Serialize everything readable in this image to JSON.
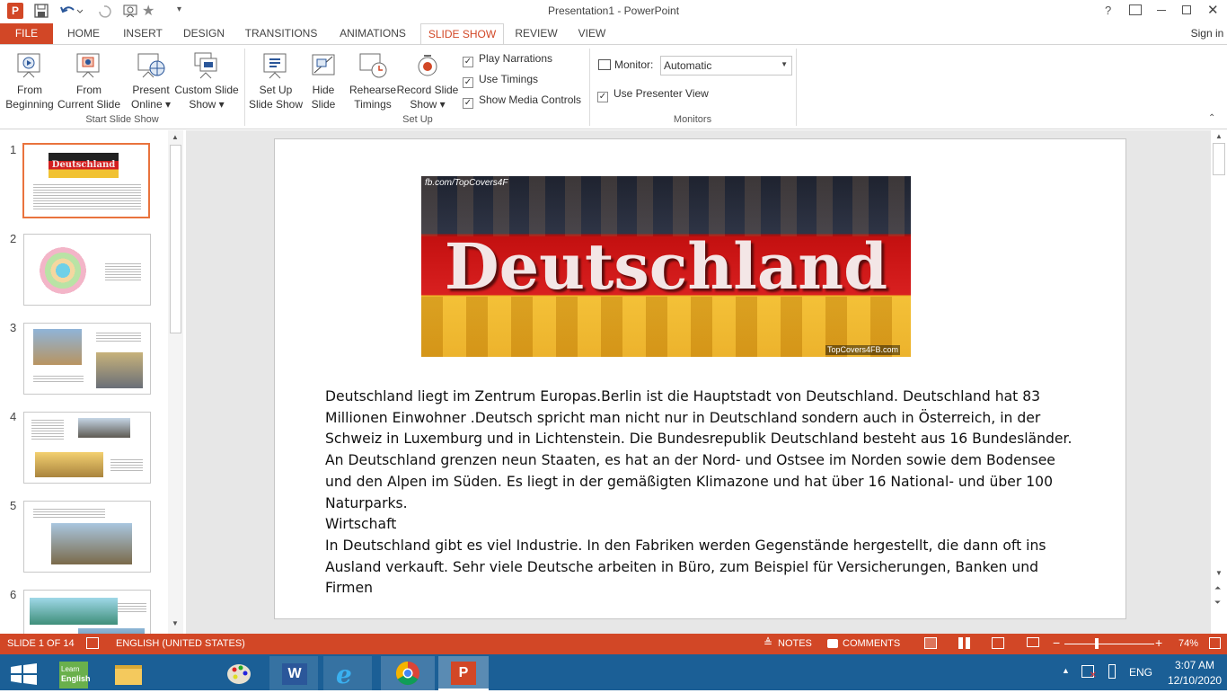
{
  "title_bar": {
    "title": "Presentation1 - PowerPoint",
    "help": "?"
  },
  "tabs": [
    {
      "label": "FILE"
    },
    {
      "label": "HOME"
    },
    {
      "label": "INSERT"
    },
    {
      "label": "DESIGN"
    },
    {
      "label": "TRANSITIONS"
    },
    {
      "label": "ANIMATIONS"
    },
    {
      "label": "SLIDE SHOW"
    },
    {
      "label": "REVIEW"
    },
    {
      "label": "VIEW"
    }
  ],
  "sign_in": "Sign in",
  "ribbon": {
    "from_beginning": [
      "From",
      "Beginning"
    ],
    "from_current": [
      "From",
      "Current Slide"
    ],
    "present_online": [
      "Present",
      "Online ▾"
    ],
    "custom_show": [
      "Custom Slide",
      "Show ▾"
    ],
    "setup_show": [
      "Set Up",
      "Slide Show"
    ],
    "hide_slide": [
      "Hide",
      "Slide"
    ],
    "rehearse": [
      "Rehearse",
      "Timings"
    ],
    "record": [
      "Record Slide",
      "Show ▾"
    ],
    "play_narrations": "Play Narrations",
    "use_timings": "Use Timings",
    "show_media": "Show Media Controls",
    "monitor_label": "Monitor:",
    "monitor_value": "Automatic",
    "presenter_view": "Use Presenter View",
    "groups": {
      "start": "Start Slide Show",
      "setup": "Set Up",
      "monitors": "Monitors"
    }
  },
  "thumbnails": [
    {
      "num": "1",
      "title": "Deutschland"
    },
    {
      "num": "2"
    },
    {
      "num": "3"
    },
    {
      "num": "4"
    },
    {
      "num": "5"
    },
    {
      "num": "6"
    }
  ],
  "slide": {
    "banner_title": "Deutschland",
    "banner_tl": "fb.com/TopCovers4F",
    "banner_br": "TopCovers4FB.com",
    "lines": [
      "Deutschland liegt im Zentrum Europas.Berlin ist die Hauptstadt von Deutschland. Deutschland hat 83",
      "Millionen Einwohner .Deutsch spricht man nicht nur in Deutschland sondern auch  in Österreich, in der",
      "Schweiz in Luxemburg und in Lichtenstein.  Die Bundesrepublik Deutschland besteht aus 16 Bundesländer.",
      "An Deutschland grenzen neun Staaten, es hat an der Nord- und Ostsee im Norden sowie dem Bodensee",
      "und den Alpen im Süden. Es liegt in der gemäßigten Klimazone und hat  über 16 National- und über 100",
      "Naturparks.",
      "Wirtschaft",
      "In Deutschland gibt es viel Industrie. In den Fabriken werden Gegenstände hergestellt, die dann oft ins",
      "Ausland verkauft. Sehr viele Deutsche arbeiten in Büro, zum Beispiel für Versicherungen, Banken und",
      "Firmen"
    ]
  },
  "status": {
    "slide": "SLIDE 1 OF 14",
    "language": "ENGLISH (UNITED STATES)",
    "notes": "NOTES",
    "comments": "COMMENTS",
    "zoom": "74%",
    "zoom_level": 0.74
  },
  "taskbar": {
    "learn_english": [
      "Learn",
      "English"
    ],
    "lang": "ENG",
    "time": "3:07 AM",
    "date": "12/10/2020"
  },
  "colors": {
    "accent": "#d24726",
    "taskbar": "#1b5f96",
    "thumb_selected": "#e9733d"
  }
}
